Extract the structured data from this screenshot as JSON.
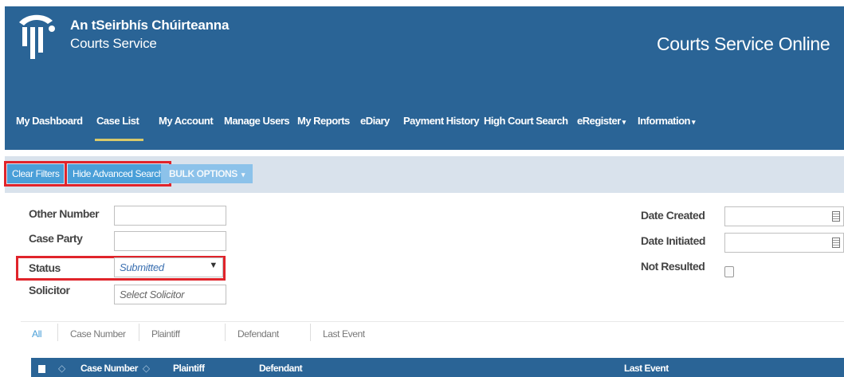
{
  "header": {
    "brand_irish": "An tSeirbhís Chúirteanna",
    "brand_english": "Courts Service",
    "site_title": "Courts Service Online"
  },
  "nav": {
    "items": [
      {
        "label": "My Dashboard"
      },
      {
        "label": "Case List"
      },
      {
        "label": "My Account"
      },
      {
        "label": "Manage Users"
      },
      {
        "label": "My Reports"
      },
      {
        "label": "eDiary"
      },
      {
        "label": "Payment History"
      },
      {
        "label": "High Court Search"
      },
      {
        "label": "eRegister"
      },
      {
        "label": "Information"
      }
    ],
    "active": "Case List"
  },
  "toolbar": {
    "clear_filters": "Clear Filters",
    "hide_advanced": "Hide Advanced Search",
    "bulk_options": "BULK OPTIONS"
  },
  "filters": {
    "other_number": {
      "label": "Other Number",
      "value": ""
    },
    "case_party": {
      "label": "Case Party",
      "value": ""
    },
    "status": {
      "label": "Status",
      "value": "Submitted"
    },
    "solicitor": {
      "label": "Solicitor",
      "placeholder": "Select Solicitor"
    },
    "date_created": {
      "label": "Date Created",
      "value": ""
    },
    "date_initiated": {
      "label": "Date Initiated",
      "value": ""
    },
    "not_resulted": {
      "label": "Not Resulted",
      "checked": false
    }
  },
  "search_tabs": [
    "All",
    "Case Number",
    "Plaintiff",
    "Defendant",
    "Last Event"
  ],
  "table": {
    "columns": [
      "Case Number",
      "Plaintiff",
      "Defendant",
      "Last Event"
    ]
  },
  "colors": {
    "primary": "#2a6496",
    "button": "#4a9fd8",
    "highlight": "#e0242b",
    "nav_underline": "#d8c96a"
  }
}
